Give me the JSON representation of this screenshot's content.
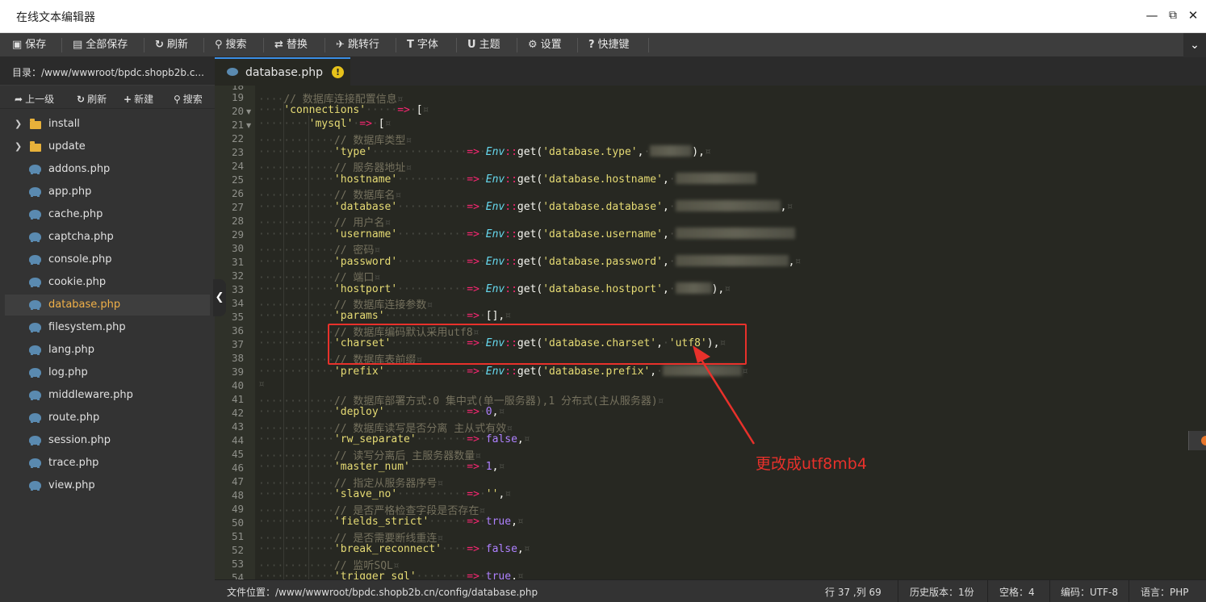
{
  "window": {
    "title": "在线文本编辑器"
  },
  "toolbar": {
    "save": "保存",
    "save_all": "全部保存",
    "refresh": "刷新",
    "search": "搜索",
    "replace": "替换",
    "goto_line": "跳转行",
    "font": "字体",
    "theme": "主题",
    "settings": "设置",
    "shortcuts": "快捷键"
  },
  "sidebar": {
    "dir": "目录：/www/wwwroot/bpdc.shopb2b.c...",
    "tools": {
      "up": "上一级",
      "refresh": "刷新",
      "new": "新建",
      "search": "搜索"
    },
    "items": [
      {
        "label": "install"
      },
      {
        "label": "update"
      },
      {
        "label": "addons.php"
      },
      {
        "label": "app.php"
      },
      {
        "label": "cache.php"
      },
      {
        "label": "captcha.php"
      },
      {
        "label": "console.php"
      },
      {
        "label": "cookie.php"
      },
      {
        "label": "database.php"
      },
      {
        "label": "filesystem.php"
      },
      {
        "label": "lang.php"
      },
      {
        "label": "log.php"
      },
      {
        "label": "middleware.php"
      },
      {
        "label": "route.php"
      },
      {
        "label": "session.php"
      },
      {
        "label": "trace.php"
      },
      {
        "label": "view.php"
      }
    ]
  },
  "tab": {
    "name": "database.php",
    "warn": "!"
  },
  "code": {
    "c19": "// 数据库连接配置信息",
    "k_connections": "'connections'",
    "k_mysql": "'mysql'",
    "c22": "// 数据库类型",
    "k_type": "'type'",
    "a_type": "'database.type'",
    "c24": "// 服务器地址",
    "k_hostname": "'hostname'",
    "a_hostname": "'database.hostname'",
    "c26": "// 数据库名",
    "k_database": "'database'",
    "a_database": "'database.database'",
    "c28": "// 用户名",
    "k_username": "'username'",
    "a_username": "'database.username'",
    "c30": "// 密码",
    "k_password": "'password'",
    "a_password": "'database.password'",
    "c32": "// 端口",
    "k_hostport": "'hostport'",
    "a_hostport": "'database.hostport'",
    "c34": "// 数据库连接参数",
    "k_params": "'params'",
    "c36": "// 数据库编码默认采用utf8",
    "k_charset": "'charset'",
    "a_charset": "'database.charset'",
    "v_charset": "'utf8'",
    "c38": "// 数据库表前缀",
    "k_prefix": "'prefix'",
    "a_prefix": "'database.prefix'",
    "c41": "// 数据库部署方式:0 集中式(单一服务器),1 分布式(主从服务器)",
    "k_deploy": "'deploy'",
    "v_deploy": "0",
    "c43": "// 数据库读写是否分离 主从式有效",
    "k_rw": "'rw_separate'",
    "c45": "// 读写分离后 主服务器数量",
    "k_master": "'master_num'",
    "v_master": "1",
    "c47": "// 指定从服务器序号",
    "k_slave": "'slave_no'",
    "v_slave": "''",
    "c49": "// 是否严格检查字段是否存在",
    "k_fields": "'fields_strict'",
    "c51": "// 是否需要断线重连",
    "k_break": "'break_reconnect'",
    "c53": "// 监听SQL",
    "k_trigger": "'trigger_sql'",
    "kw_env": "Env",
    "kw_get": "get",
    "kw_arrow": "=>",
    "kw_false": "false",
    "kw_true": "true"
  },
  "annotation": "更改成utf8mb4",
  "status": {
    "file_path": "文件位置：/www/wwwroot/bpdc.shopb2b.cn/config/database.php",
    "cursor": "行 37 ,列 69",
    "history": "历史版本：1份",
    "spaces": "空格：4",
    "encoding": "编码：UTF-8",
    "language": "语言：PHP"
  },
  "colors": {
    "highlight": "#e8312b",
    "active_file": "#f0b048",
    "tab_accent": "#3a8ee6"
  }
}
